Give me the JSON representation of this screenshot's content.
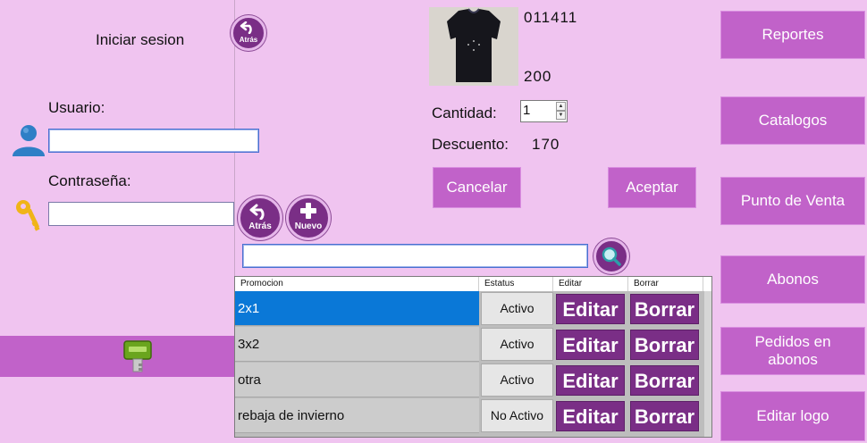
{
  "login": {
    "title": "Iniciar sesion",
    "user_label": "Usuario:",
    "user_value": "",
    "password_label": "Contraseña:",
    "password_value": ""
  },
  "buttons": {
    "back_top": "Atrás",
    "back": "Atrás",
    "new": "Nuevo"
  },
  "product": {
    "code": "011411",
    "price": "200",
    "quantity_label": "Cantidad:",
    "quantity_value": "1",
    "discount_label": "Descuento:",
    "discount_value": "170",
    "cancel_label": "Cancelar",
    "accept_label": "Aceptar"
  },
  "search": {
    "value": ""
  },
  "table": {
    "headers": [
      "Promocion",
      "Estatus",
      "Editar",
      "Borrar"
    ],
    "rows": [
      {
        "promocion": "2x1",
        "estatus": "Activo",
        "editar": "Editar",
        "borrar": "Borrar"
      },
      {
        "promocion": "3x2",
        "estatus": "Activo",
        "editar": "Editar",
        "borrar": "Borrar"
      },
      {
        "promocion": "otra",
        "estatus": "Activo",
        "editar": "Editar",
        "borrar": "Borrar"
      },
      {
        "promocion": "rebaja de invierno",
        "estatus": "No Activo",
        "editar": "Editar",
        "borrar": "Borrar"
      }
    ]
  },
  "sidebar": {
    "items": [
      {
        "label": "Reportes"
      },
      {
        "label": "Catalogos"
      },
      {
        "label": "Punto de Venta"
      },
      {
        "label": "Abonos"
      },
      {
        "label": "Pedidos en abonos"
      },
      {
        "label": "Editar logo"
      }
    ]
  },
  "colors": {
    "background": "#f0c4f0",
    "accent": "#c162c9",
    "dark_purple": "#7a2e86",
    "selection": "#0a78d7"
  }
}
